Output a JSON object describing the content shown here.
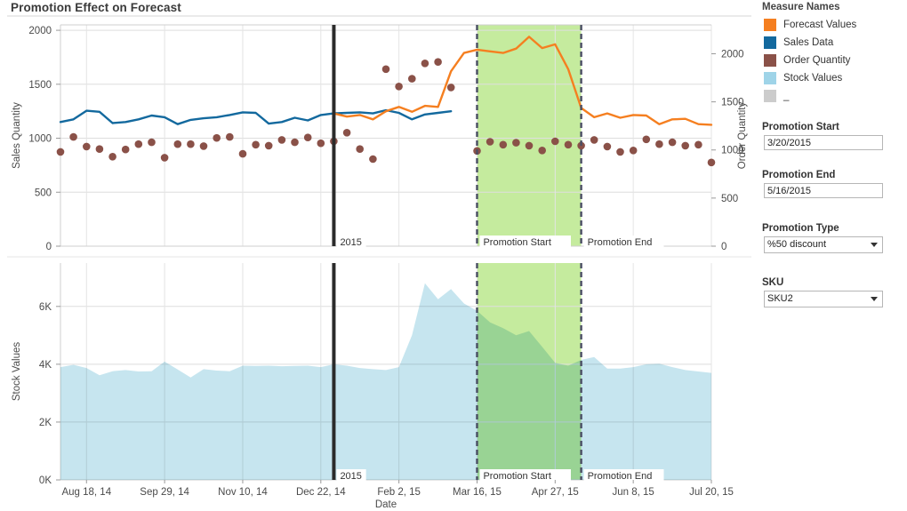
{
  "title": "Promotion Effect on Forecast",
  "legend": {
    "title": "Measure Names",
    "items": [
      {
        "label": "Forecast Values",
        "color": "#f57f20",
        "icon": "color-swatch"
      },
      {
        "label": "Sales Data",
        "color": "#13699e",
        "icon": "color-swatch"
      },
      {
        "label": "Order Quantity",
        "color": "#8a5148",
        "icon": "color-swatch"
      },
      {
        "label": "Stock Values",
        "color": "#9fd4e8",
        "icon": "color-swatch"
      },
      {
        "label": "_",
        "color": "#cccccc",
        "icon": "color-swatch"
      }
    ]
  },
  "controls": {
    "promotion_start": {
      "label": "Promotion Start",
      "value": "3/20/2015"
    },
    "promotion_end": {
      "label": "Promotion End",
      "value": "5/16/2015"
    },
    "promotion_type": {
      "label": "Promotion Type",
      "value": "%50 discount",
      "icon": "chevron-down-icon"
    },
    "sku": {
      "label": "SKU",
      "value": "SKU2",
      "icon": "chevron-down-icon"
    }
  },
  "reference_lines": [
    {
      "name": "year-marker",
      "label": "2015",
      "x_value": "Jan 1, 2015",
      "color": "#2b2b2b",
      "style": "solid"
    },
    {
      "name": "promotion-start-marker",
      "label": "Promotion Start",
      "x_value": "3/20/2015",
      "color": "#4a4e63",
      "style": "dashed"
    },
    {
      "name": "promotion-end-marker",
      "label": "Promotion End",
      "x_value": "5/16/2015",
      "color": "#4a4e63",
      "style": "dashed"
    }
  ],
  "band": {
    "name": "promotion-band",
    "color": "#c5eb9e",
    "from": "3/20/2015",
    "to": "5/16/2015"
  },
  "chart_data": [
    {
      "type": "line",
      "name": "upper-chart",
      "title": "Promotion Effect on Forecast",
      "xlabel": "",
      "ylabel": "Sales Quantity",
      "y2label": "Order Quantity",
      "ylim": [
        0,
        2050
      ],
      "y2lim": [
        0,
        2300
      ],
      "yticks": [
        0,
        500,
        1000,
        1500,
        2000
      ],
      "y2ticks": [
        0,
        500,
        1000,
        1500,
        2000
      ],
      "grid": true,
      "legend_position": "right",
      "x": [
        "2014-08-04",
        "2014-08-11",
        "2014-08-18",
        "2014-08-25",
        "2014-09-01",
        "2014-09-08",
        "2014-09-15",
        "2014-09-22",
        "2014-09-29",
        "2014-10-06",
        "2014-10-13",
        "2014-10-20",
        "2014-10-27",
        "2014-11-03",
        "2014-11-10",
        "2014-11-17",
        "2014-11-24",
        "2014-12-01",
        "2014-12-08",
        "2014-12-15",
        "2014-12-22",
        "2014-12-29",
        "2015-01-05",
        "2015-01-12",
        "2015-01-19",
        "2015-01-26",
        "2015-02-02",
        "2015-02-09",
        "2015-02-16",
        "2015-02-23",
        "2015-03-02",
        "2015-03-09",
        "2015-03-16",
        "2015-03-23",
        "2015-03-30",
        "2015-04-06",
        "2015-04-13",
        "2015-04-20",
        "2015-04-27",
        "2015-05-04",
        "2015-05-11",
        "2015-05-18",
        "2015-05-25",
        "2015-06-01",
        "2015-06-08",
        "2015-06-15",
        "2015-06-22",
        "2015-06-29",
        "2015-07-06",
        "2015-07-13",
        "2015-07-20"
      ],
      "series": [
        {
          "name": "Sales Data",
          "color": "#13699e",
          "values": [
            1150,
            1175,
            1255,
            1245,
            1140,
            1150,
            1175,
            1210,
            1195,
            1130,
            1170,
            1185,
            1195,
            1215,
            1240,
            1235,
            1135,
            1150,
            1190,
            1165,
            1215,
            1230,
            1235,
            1240,
            1230,
            1260,
            1235,
            1175,
            1220,
            1235,
            1250,
            null,
            null,
            null,
            null,
            null,
            null,
            null,
            null,
            null,
            null,
            null,
            null,
            null,
            null,
            null,
            null,
            null,
            null,
            null,
            null
          ]
        },
        {
          "name": "Forecast Values",
          "color": "#f57f20",
          "values": [
            null,
            null,
            null,
            null,
            null,
            null,
            null,
            null,
            null,
            null,
            null,
            null,
            null,
            null,
            null,
            null,
            null,
            null,
            null,
            null,
            null,
            1230,
            1200,
            1215,
            1175,
            1250,
            1290,
            1245,
            1300,
            1290,
            1620,
            1790,
            1820,
            1805,
            1790,
            1830,
            1940,
            1835,
            1870,
            1640,
            1280,
            1195,
            1230,
            1190,
            1215,
            1210,
            1130,
            1175,
            1180,
            1130,
            1125
          ]
        }
      ],
      "scatter": [
        {
          "name": "Order Quantity",
          "color": "#8a5148",
          "values": [
            980,
            1135,
            1035,
            1010,
            930,
            1005,
            1060,
            1080,
            920,
            1060,
            1060,
            1040,
            1125,
            1135,
            960,
            1055,
            1045,
            1105,
            1080,
            1130,
            1070,
            1090,
            1180,
            1010,
            905,
            1840,
            1660,
            1740,
            1900,
            1915,
            1650,
            null,
            990,
            1085,
            1055,
            1075,
            1045,
            995,
            1090,
            1055,
            1045,
            1105,
            1035,
            980,
            995,
            1110,
            1060,
            1080,
            1045,
            1055,
            870
          ]
        }
      ]
    },
    {
      "type": "area",
      "name": "lower-chart",
      "title": "",
      "xlabel": "Date",
      "ylabel": "Stock Values",
      "ylim": [
        0,
        7500
      ],
      "yticks": [
        0,
        2000,
        4000,
        6000
      ],
      "ytick_labels": [
        "0K",
        "2K",
        "4K",
        "6K"
      ],
      "grid": true,
      "xticks": [
        "Aug 18, 14",
        "Sep 29, 14",
        "Nov 10, 14",
        "Dec 22, 14",
        "Feb 2, 15",
        "Mar 16, 15",
        "Apr 27, 15",
        "Jun 8, 15",
        "Jul 20, 15"
      ],
      "x": [
        "2014-08-04",
        "2014-08-11",
        "2014-08-18",
        "2014-08-25",
        "2014-09-01",
        "2014-09-08",
        "2014-09-15",
        "2014-09-22",
        "2014-09-29",
        "2014-10-06",
        "2014-10-13",
        "2014-10-20",
        "2014-10-27",
        "2014-11-03",
        "2014-11-10",
        "2014-11-17",
        "2014-11-24",
        "2014-12-01",
        "2014-12-08",
        "2014-12-15",
        "2014-12-22",
        "2014-12-29",
        "2015-01-05",
        "2015-01-12",
        "2015-01-19",
        "2015-01-26",
        "2015-02-02",
        "2015-02-09",
        "2015-02-16",
        "2015-02-23",
        "2015-03-02",
        "2015-03-09",
        "2015-03-16",
        "2015-03-23",
        "2015-03-30",
        "2015-04-06",
        "2015-04-13",
        "2015-04-20",
        "2015-04-27",
        "2015-05-04",
        "2015-05-11",
        "2015-05-18",
        "2015-05-25",
        "2015-06-01",
        "2015-06-08",
        "2015-06-15",
        "2015-06-22",
        "2015-06-29",
        "2015-07-06",
        "2015-07-13",
        "2015-07-20"
      ],
      "series": [
        {
          "name": "Stock Values",
          "color": "#b9dfec",
          "values": [
            3900,
            3980,
            3870,
            3620,
            3760,
            3800,
            3750,
            3760,
            4090,
            3820,
            3540,
            3830,
            3780,
            3760,
            3950,
            3940,
            3950,
            3930,
            3940,
            3950,
            3900,
            4000,
            3950,
            3870,
            3830,
            3800,
            3900,
            5000,
            6800,
            6250,
            6600,
            6100,
            5850,
            5450,
            5250,
            5000,
            5150,
            4600,
            4050,
            3950,
            4150,
            4250,
            3850,
            3850,
            3900,
            4000,
            4020,
            3900,
            3800,
            3750,
            3700
          ]
        }
      ]
    }
  ]
}
